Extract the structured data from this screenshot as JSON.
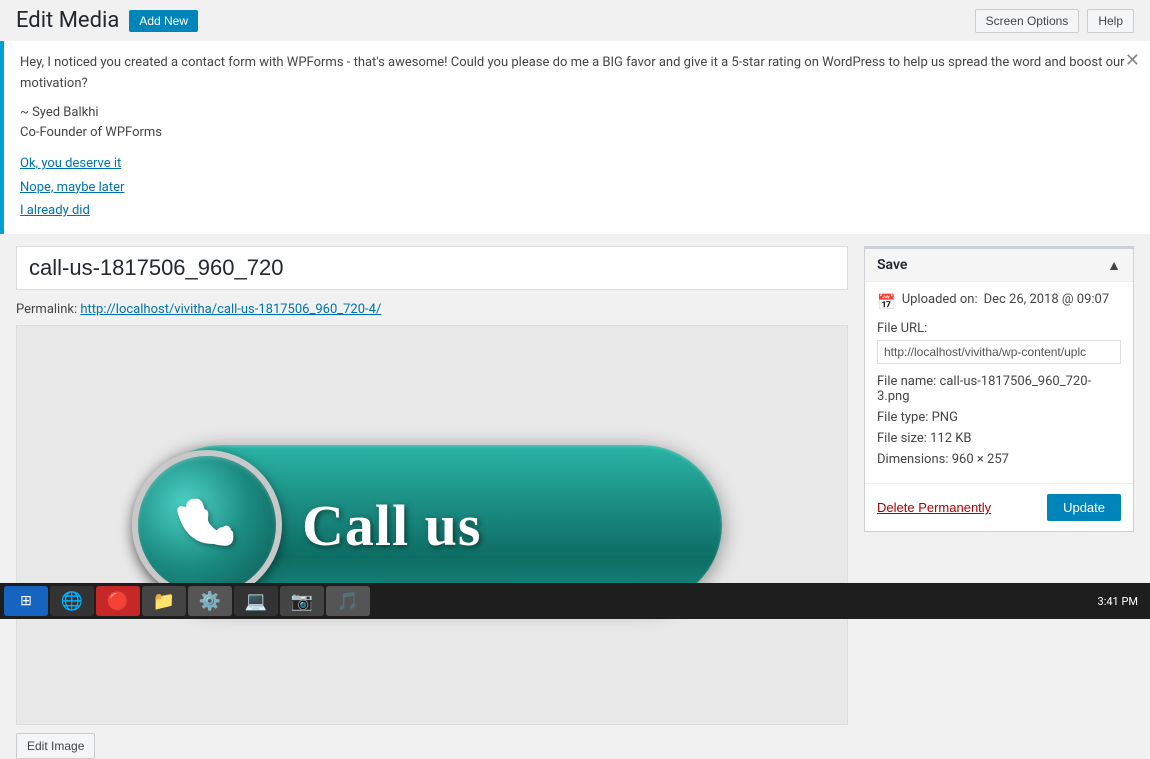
{
  "header": {
    "title": "Edit Media",
    "add_new_label": "Add New",
    "screen_options_label": "Screen Options",
    "help_label": "Help"
  },
  "notification": {
    "message": "Hey, I noticed you created a contact form with WPForms - that's awesome! Could you please do me a BIG favor and give it a 5-star rating on WordPress to help us spread the word and boost our motivation?",
    "author_line1": "~ Syed Balkhi",
    "author_line2": "Co-Founder of WPForms",
    "link1": "Ok, you deserve it",
    "link2": "Nope, maybe later",
    "link3": "I already did"
  },
  "media": {
    "title_value": "call-us-1817506_960_720",
    "permalink_label": "Permalink:",
    "permalink_url": "http://localhost/vivitha/call-us-1817506_960_720-4/",
    "call_us_text": "Call us",
    "edit_image_label": "Edit Image"
  },
  "save_panel": {
    "title": "Save",
    "uploaded_label": "Uploaded on:",
    "uploaded_value": "Dec 26, 2018 @ 09:07",
    "file_url_label": "File URL:",
    "file_url_value": "http://localhost/vivitha/wp-content/uplc",
    "file_name_label": "File name: call-us-1817506_960_720-3.png",
    "file_type_label": "File type: PNG",
    "file_size_label": "File size: 112 KB",
    "dimensions_label": "Dimensions: 960 × 257",
    "delete_label": "Delete Permanently",
    "update_label": "Update"
  },
  "taskbar": {
    "time": "3:41 PM"
  }
}
